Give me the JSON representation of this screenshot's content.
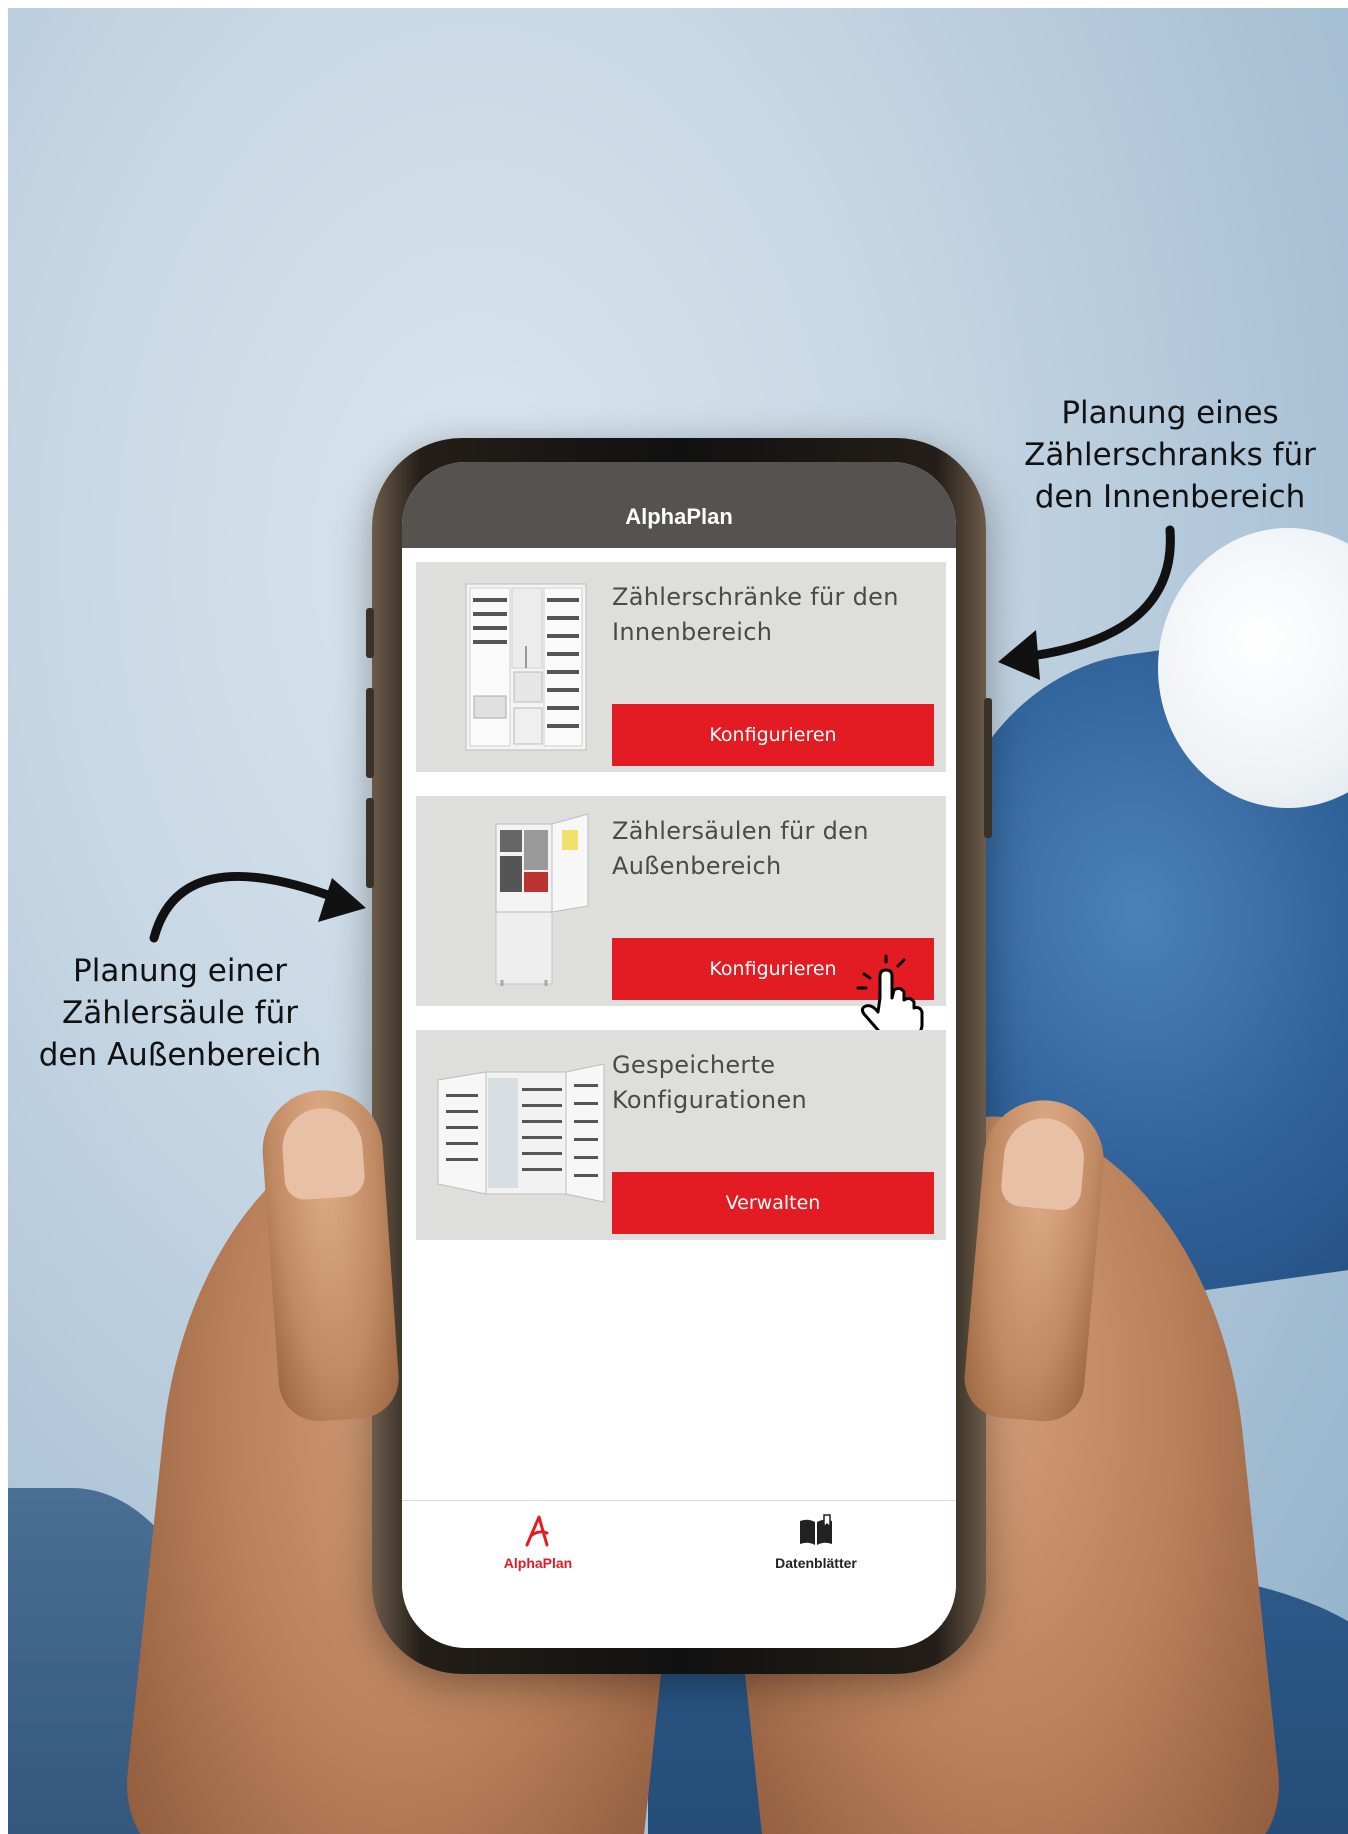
{
  "app": {
    "title": "AlphaPlan"
  },
  "cards": [
    {
      "title_line1": "Zählerschränke für den",
      "title_line2": "Innenbereich",
      "button_label": "Konfigurieren"
    },
    {
      "title_line1": "Zählersäulen für den",
      "title_line2": "Außenbereich",
      "button_label": "Konfigurieren"
    },
    {
      "title_line1": "Gespeicherte",
      "title_line2": "Konfigurationen",
      "button_label": "Verwalten"
    }
  ],
  "tabbar": {
    "tabs": [
      {
        "label": "AlphaPlan",
        "icon": "alphaplan-logo-icon",
        "active": true
      },
      {
        "label": "Datenblätter",
        "icon": "open-book-icon",
        "active": false
      }
    ]
  },
  "annotations": {
    "right": {
      "line1": "Planung eines",
      "line2": "Zählerschranks für",
      "line3": "den Innenbereich"
    },
    "left": {
      "line1": "Planung einer",
      "line2": "Zählersäule für",
      "line3": "den Außenbereich"
    }
  },
  "colors": {
    "accent": "#e31b23",
    "header": "#555250",
    "card": "#dededd"
  }
}
